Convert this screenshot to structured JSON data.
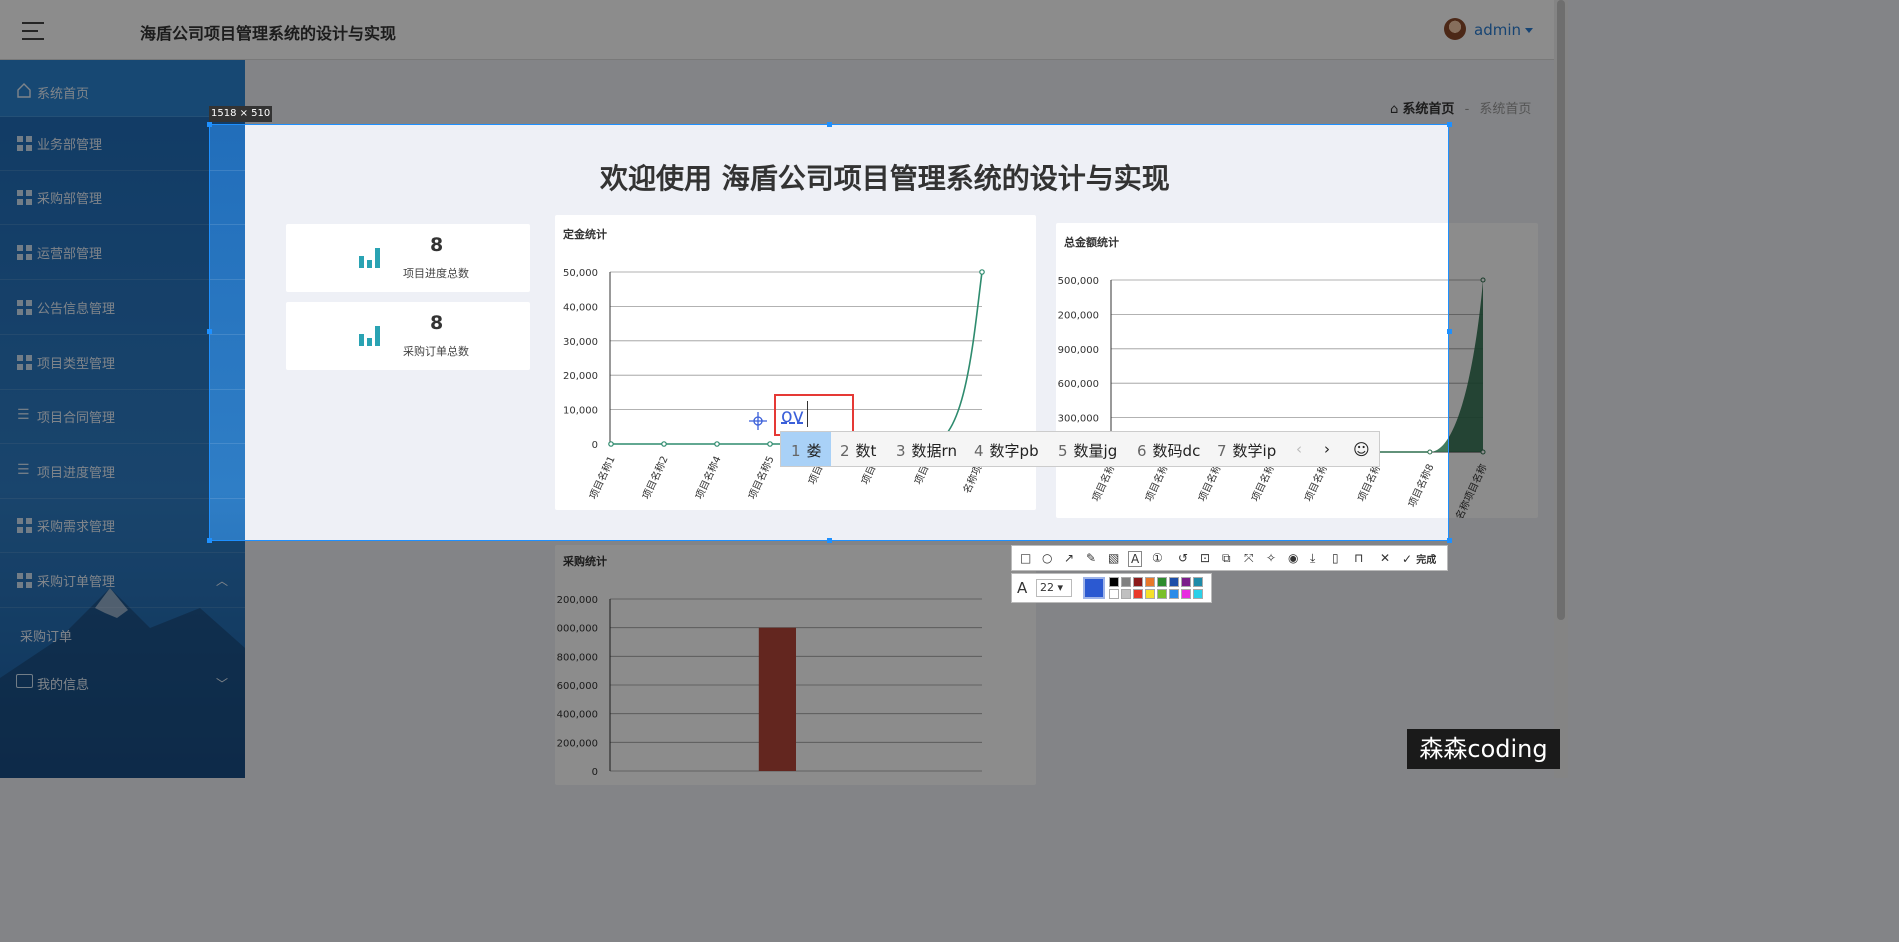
{
  "header": {
    "title": "海盾公司项目管理系统的设计与实现",
    "user": "admin"
  },
  "sidebar": {
    "home": "系统首页",
    "items": [
      {
        "label": "业务部管理"
      },
      {
        "label": "采购部管理"
      },
      {
        "label": "运营部管理"
      },
      {
        "label": "公告信息管理"
      },
      {
        "label": "项目类型管理"
      },
      {
        "label": "项目合同管理"
      },
      {
        "label": "项目进度管理"
      },
      {
        "label": "采购需求管理"
      },
      {
        "label": "采购订单管理"
      }
    ],
    "sub_item": "采购订单",
    "my_info": "我的信息"
  },
  "breadcrumb": {
    "home": "系统首页",
    "sep": "-",
    "current": "系统首页"
  },
  "welcome": "欢迎使用 海盾公司项目管理系统的设计与实现",
  "stats": [
    {
      "value": "8",
      "label": "项目进度总数"
    },
    {
      "value": "8",
      "label": "采购订单总数"
    }
  ],
  "chart_data": [
    {
      "type": "line",
      "title": "定金统计",
      "categories": [
        "项目名称1",
        "项目名称2",
        "项目名称4",
        "项目名称5",
        "项目名",
        "项目名",
        "项目名",
        "名称项目"
      ],
      "values": [
        0,
        0,
        0,
        0,
        0,
        0,
        0,
        50000
      ],
      "ylim": [
        0,
        50000
      ],
      "yticks": [
        "50,000",
        "40,000",
        "30,000",
        "20,000",
        "10,000",
        "0"
      ],
      "color": "#2e8b6e"
    },
    {
      "type": "area",
      "title": "总金额统计",
      "categories": [
        "项目名称",
        "项目名称",
        "项目名称",
        "项目名称",
        "项目名称",
        "项目名称",
        "项目名称8",
        "名称项目名称"
      ],
      "yticks": [
        "500,000",
        "200,000",
        "900,000",
        "600,000",
        "300,000"
      ],
      "color": "#2e6e4e"
    },
    {
      "type": "bar",
      "title": "采购统计",
      "yticks": [
        "200,000",
        "000,000",
        "800,000",
        "600,000",
        "400,000",
        "200,000",
        "0"
      ],
      "highlight_index": 3,
      "color": "#b5453a"
    }
  ],
  "overlay": {
    "size_label": "1518 × 510",
    "text_input": "ov",
    "ime_candidates": [
      {
        "num": "1",
        "text": "娄"
      },
      {
        "num": "2",
        "text": "数t"
      },
      {
        "num": "3",
        "text": "数据rn"
      },
      {
        "num": "4",
        "text": "数字pb"
      },
      {
        "num": "5",
        "text": "数量jg"
      },
      {
        "num": "6",
        "text": "数码dc"
      },
      {
        "num": "7",
        "text": "数学ip"
      }
    ],
    "done_label": "完成",
    "font_size": "22"
  },
  "colors": {
    "selection": "#1e90ff",
    "palette": [
      "#000000",
      "#808080",
      "#8b1a1a",
      "#e8782a",
      "#2e8b2e",
      "#1e4fa8",
      "#7b1e8b",
      "#1e8ba8",
      "#ffffff",
      "#c0c0c0",
      "#e83a2a",
      "#f5e02a",
      "#7ac02a",
      "#2a8be8",
      "#e82ae0",
      "#2ad0e8"
    ]
  },
  "watermark": "森森coding"
}
